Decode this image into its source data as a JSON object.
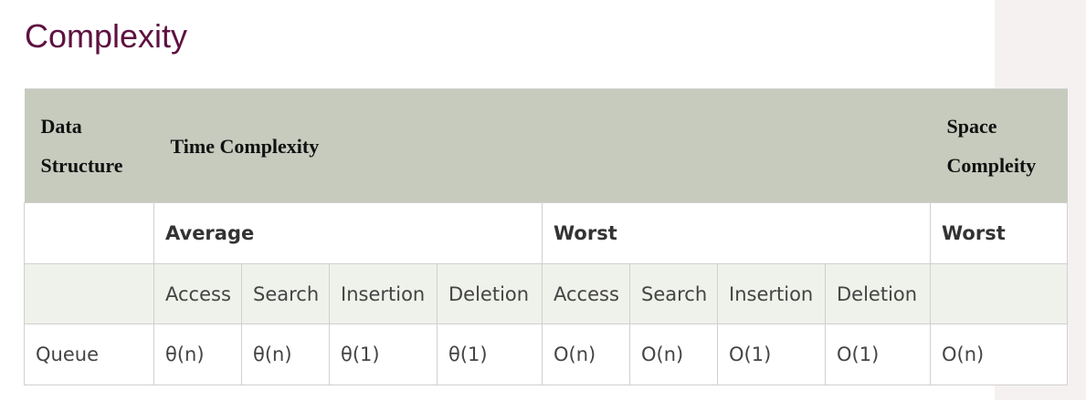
{
  "title": "Complexity",
  "table": {
    "header": {
      "data_structure": "Data Structure",
      "time_complexity": "Time Complexity",
      "space_complexity": "Space Compleity"
    },
    "cases": {
      "first": "",
      "average": "Average",
      "worst_time": "Worst",
      "worst_space": "Worst"
    },
    "operations": [
      "",
      "Access",
      "Search",
      "Insertion",
      "Deletion",
      "Access",
      "Search",
      "Insertion",
      "Deletion",
      ""
    ],
    "rows": [
      {
        "name": "Queue",
        "cells": [
          "θ(n)",
          "θ(n)",
          "θ(1)",
          "θ(1)",
          "O(n)",
          "O(n)",
          "O(1)",
          "O(1)",
          "O(n)"
        ]
      }
    ]
  },
  "colors": {
    "title": "#5e1140",
    "header_bg": "#c6cbbe",
    "op_row_bg": "#eff1eb",
    "side_panel_bg": "#f6f1f1"
  }
}
